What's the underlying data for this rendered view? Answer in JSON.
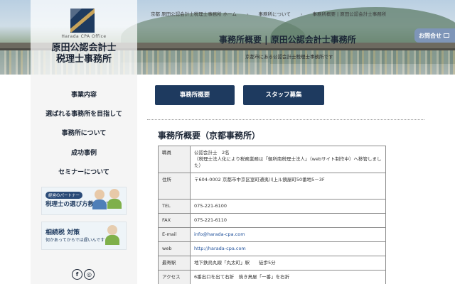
{
  "logo": {
    "sub": "Harada CPA Office",
    "name_line1": "原田公認会計士",
    "name_line2": "税理士事務所"
  },
  "breadcrumb": [
    "京都 原田公認会計士税理士事務所 ホーム",
    "事務所について",
    "事務所概要 | 原田公認会計士事務所"
  ],
  "hero": {
    "title": "事務所概要 | 原田公認会計士事務所",
    "subtitle": "京都市にある公認会計士税理士事務所です"
  },
  "contact_tab": {
    "label": "お問合せ",
    "icon": "mail-icon"
  },
  "sidebar": {
    "items": [
      {
        "label": "事業内容"
      },
      {
        "label": "選ばれる事務所を目指して"
      },
      {
        "label": "事務所について"
      },
      {
        "label": "成功事例"
      },
      {
        "label": "セミナーについて"
      }
    ],
    "banner1": {
      "tag": "経営のパートナー",
      "text": "税理士の選び方教えます"
    },
    "banner2": {
      "title": "相続税 対策",
      "text": "何かあってからでは遅いんです…"
    },
    "social": [
      "facebook-icon",
      "instagram-icon"
    ]
  },
  "buttons": {
    "overview": "事務所概要",
    "recruit": "スタッフ募集"
  },
  "section": {
    "title": "事務所概要（京都事務所）"
  },
  "table": [
    {
      "label": "職員",
      "lines": [
        "公認会計士　2名",
        "（税理士法人化により税務業務は「御所南税理士法人」（webサイト制作中）へ移管しました）"
      ]
    },
    {
      "label": "住所",
      "lines": [
        "〒604-0002 京都市中京区室町通夷川上ル鏡屋町50番地5－3F"
      ]
    },
    {
      "label": "TEL",
      "lines": [
        "075-221-6100"
      ]
    },
    {
      "label": "FAX",
      "lines": [
        "075-221-6110"
      ]
    },
    {
      "label": "E-mail",
      "lines": [
        "info@harada-cpa.com"
      ],
      "link": true
    },
    {
      "label": "web",
      "lines": [
        "http://harada-cpa.com"
      ],
      "link": true
    },
    {
      "label": "最寄駅",
      "lines": [
        "地下鉄烏丸線「丸太町」駅　　徒歩5分"
      ]
    },
    {
      "label": "アクセス",
      "lines": [
        "6番出口を出て右折　焼き鳥屋「一番」を右折"
      ]
    }
  ],
  "colors": {
    "navy": "#1e3a5f",
    "link": "#1e4f9a",
    "contact_tab": "#7e95b8"
  }
}
